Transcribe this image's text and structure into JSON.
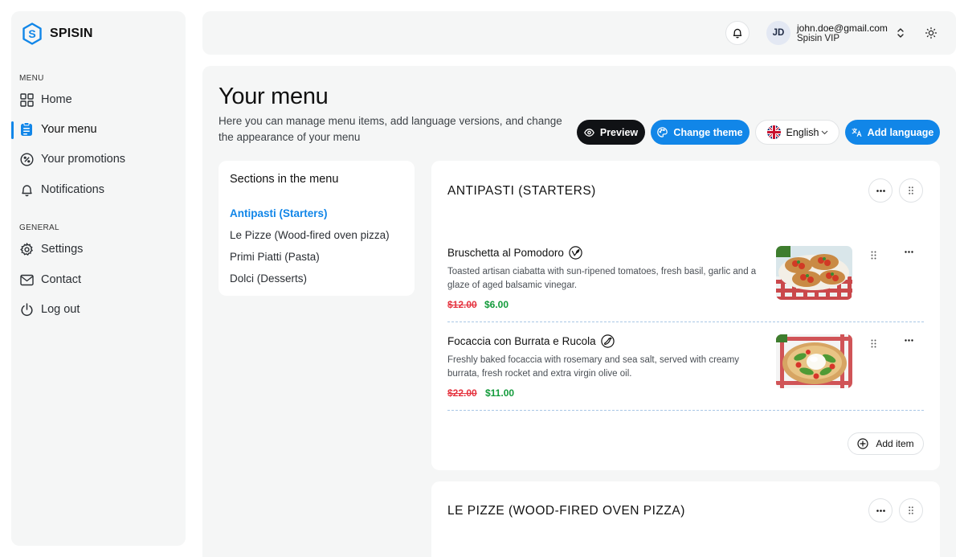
{
  "brand": {
    "name": "SPISIN"
  },
  "sidebar": {
    "menu_label": "MENU",
    "general_label": "GENERAL",
    "menu_items": [
      {
        "label": "Home",
        "icon": "home-grid-icon"
      },
      {
        "label": "Your menu",
        "icon": "menu-clipboard-icon",
        "active": true
      },
      {
        "label": "Your promotions",
        "icon": "percent-icon"
      },
      {
        "label": "Notifications",
        "icon": "bell-icon"
      }
    ],
    "general_items": [
      {
        "label": "Settings",
        "icon": "gear-icon"
      },
      {
        "label": "Contact",
        "icon": "mail-icon"
      },
      {
        "label": "Log out",
        "icon": "power-icon"
      }
    ]
  },
  "topbar": {
    "user_initials": "JD",
    "user_email": "john.doe@gmail.com",
    "user_plan": "Spisin VIP"
  },
  "page": {
    "title": "Your menu",
    "description": "Here you can manage menu items, add language versions, and change the appearance of your menu"
  },
  "toolbar": {
    "preview_label": "Preview",
    "change_theme_label": "Change theme",
    "language_label": "English",
    "add_language_label": "Add language"
  },
  "sections": {
    "title": "Sections in the menu",
    "items": [
      {
        "label": "Antipasti (Starters)",
        "active": true
      },
      {
        "label": "Le Pizze (Wood-fired oven pizza)"
      },
      {
        "label": "Primi Piatti (Pasta)"
      },
      {
        "label": "Dolci (Desserts)"
      }
    ]
  },
  "categories": [
    {
      "title": "ANTIPASTI (STARTERS)",
      "items": [
        {
          "name": "Bruschetta al Pomodoro",
          "badge_icon": "vegan-leaf-icon",
          "description": "Toasted artisan ciabatta with sun-ripened tomatoes, fresh basil, garlic and a glaze of aged balsamic vinegar.",
          "old_price": "$12.00",
          "new_price": "$6.00"
        },
        {
          "name": "Focaccia con Burrata e Rucola",
          "badge_icon": "spicy-pepper-icon",
          "description": "Freshly baked focaccia with rosemary and sea salt, served with creamy burrata, fresh rocket and extra virgin olive oil.",
          "old_price": "$22.00",
          "new_price": "$11.00"
        }
      ],
      "add_item_label": "Add item"
    },
    {
      "title": "LE PIZZE (WOOD-FIRED OVEN PIZZA)"
    }
  ],
  "colors": {
    "accent": "#1186e8",
    "panel": "#f5f6f6",
    "price_old": "#e5333f",
    "price_new": "#139b3b"
  }
}
